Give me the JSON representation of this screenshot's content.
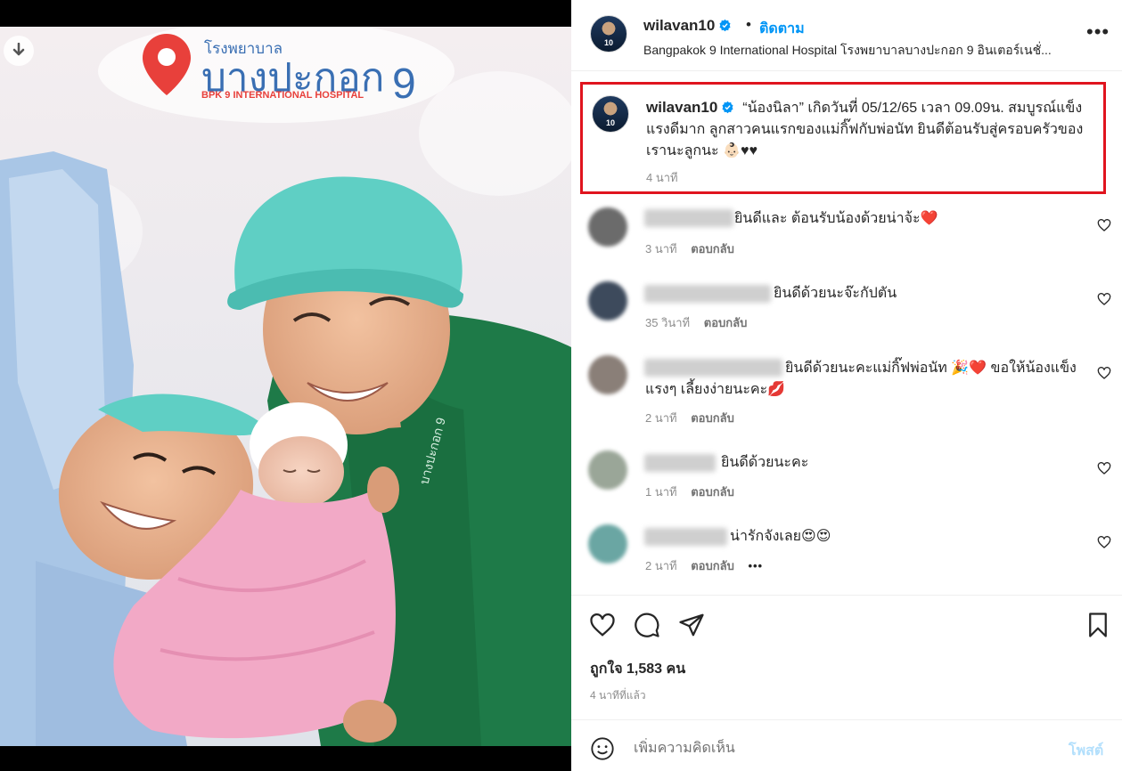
{
  "header": {
    "username": "wilavan10",
    "separator": "•",
    "follow_label": "ติดตาม",
    "location": "Bangpakok 9 International Hospital โรงพยาบาลบางปะกอก 9 อินเตอร์เนชั่...",
    "more_label": "•••"
  },
  "photo": {
    "sign_top": "โรงพยาบาล",
    "sign_main": "บางปะกอก",
    "sign_number": "9",
    "sign_sub": "BPK 9 INTERNATIONAL HOSPITAL",
    "scrub_text": "บางปะกอก 9"
  },
  "caption": {
    "username": "wilavan10",
    "text": "“น้องนิลา” เกิดวันที่ 05/12/65 เวลา 09.09น. สมบูรณ์แข็งแรงดีมาก ลูกสาวคนแรกของแม่กิ๊ฟกับพ่อนัท ยินดีต้อนรับสู่ครอบครัวของเรานะลูกนะ 👶🏻♥♥",
    "time": "4 นาที"
  },
  "comments": [
    {
      "text": "ยินดีและ ต้อนรับน้องด้วยน่าจ้ะ❤️",
      "time": "3 นาที",
      "reply": "ตอบกลับ",
      "more": ""
    },
    {
      "text": "ยินดีด้วยนะจ๊ะกัปตัน",
      "time": "35 วินาที",
      "reply": "ตอบกลับ",
      "more": ""
    },
    {
      "text": "ยินดีด้วยนะคะแม่กิ๊ฟพ่อนัท 🎉❤️ ขอให้น้องแข็งแรงๆ เลี้ยงง่ายนะคะ💋",
      "time": "2 นาที",
      "reply": "ตอบกลับ",
      "more": ""
    },
    {
      "text": "ยินดีด้วยนะคะ",
      "time": "1 นาที",
      "reply": "ตอบกลับ",
      "more": ""
    },
    {
      "text": "น่ารักจังเลย😍😍",
      "time": "2 นาที",
      "reply": "ตอบกลับ",
      "more": "•••"
    }
  ],
  "likes": "ถูกใจ 1,583 คน",
  "posted_time": "4 นาทีที่แล้ว",
  "add_comment": {
    "placeholder": "เพิ่มความคิดเห็น",
    "post_label": "โพสต์"
  },
  "colors": {
    "accent": "#0095f6",
    "highlight_border": "#e0141e",
    "scrubs": "#1e7a48",
    "cap": "#5fcfc4",
    "blanket": "#f2a9c6"
  },
  "icons": [
    "download-icon",
    "verified-icon",
    "more-icon",
    "heart-icon",
    "comment-icon",
    "share-icon",
    "bookmark-icon",
    "emoji-icon"
  ]
}
